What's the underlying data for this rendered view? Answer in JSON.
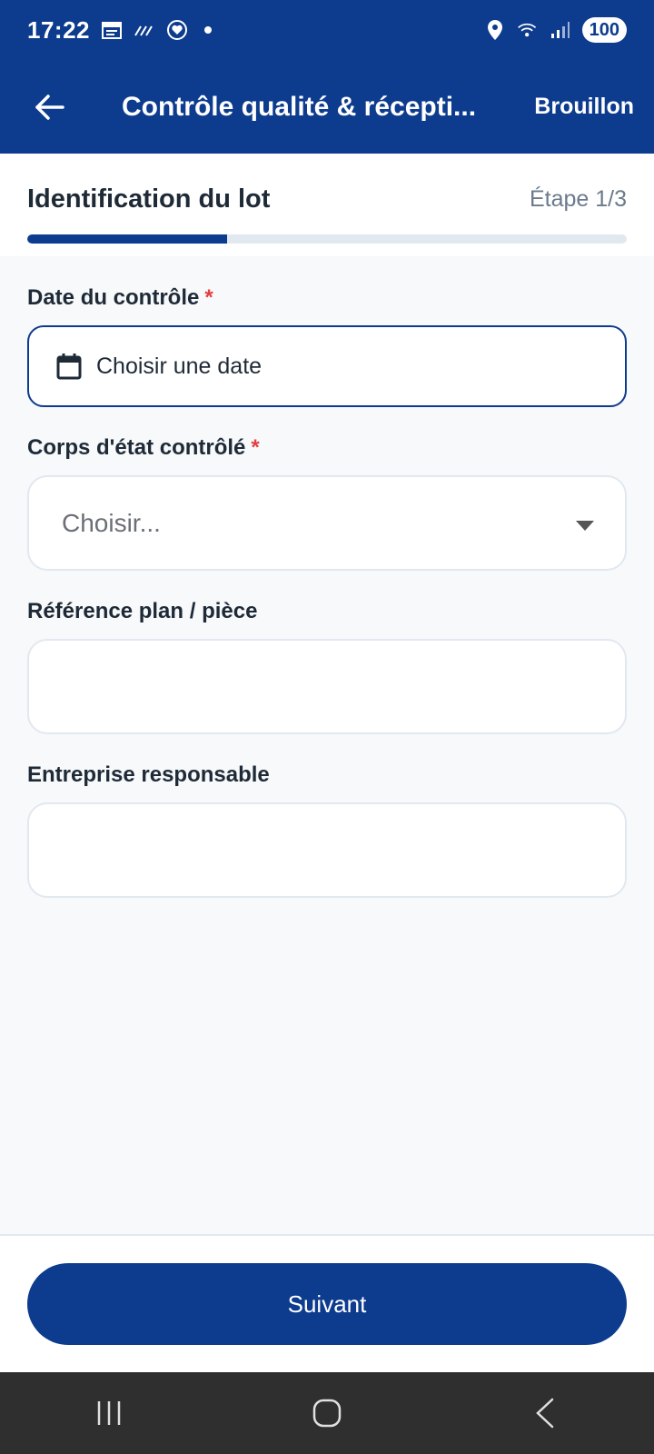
{
  "status_bar": {
    "time": "17:22",
    "left_icons": [
      "calendar-icon",
      "signal-lines-icon",
      "heart-shield-icon",
      "notification-dot"
    ],
    "right_icons": [
      "location-icon",
      "wifi-icon",
      "cell-signal-icon"
    ],
    "battery": "100"
  },
  "app_bar": {
    "title": "Contrôle qualité & récepti...",
    "action_label": "Brouillon"
  },
  "step": {
    "title": "Identification du lot",
    "counter": "Étape 1/3",
    "progress": 0.333
  },
  "form": {
    "date": {
      "label": "Date du contrôle",
      "required_mark": "*",
      "placeholder": "Choisir une date"
    },
    "trade": {
      "label": "Corps d'état contrôlé",
      "required_mark": "*",
      "placeholder": "Choisir..."
    },
    "reference": {
      "label": "Référence plan / pièce",
      "value": ""
    },
    "company": {
      "label": "Entreprise responsable",
      "value": ""
    }
  },
  "footer": {
    "next_label": "Suivant"
  },
  "colors": {
    "primary": "#0d3b8e",
    "required": "#e53e3e",
    "background": "#f7f9fb",
    "border": "#e2e8f0"
  }
}
